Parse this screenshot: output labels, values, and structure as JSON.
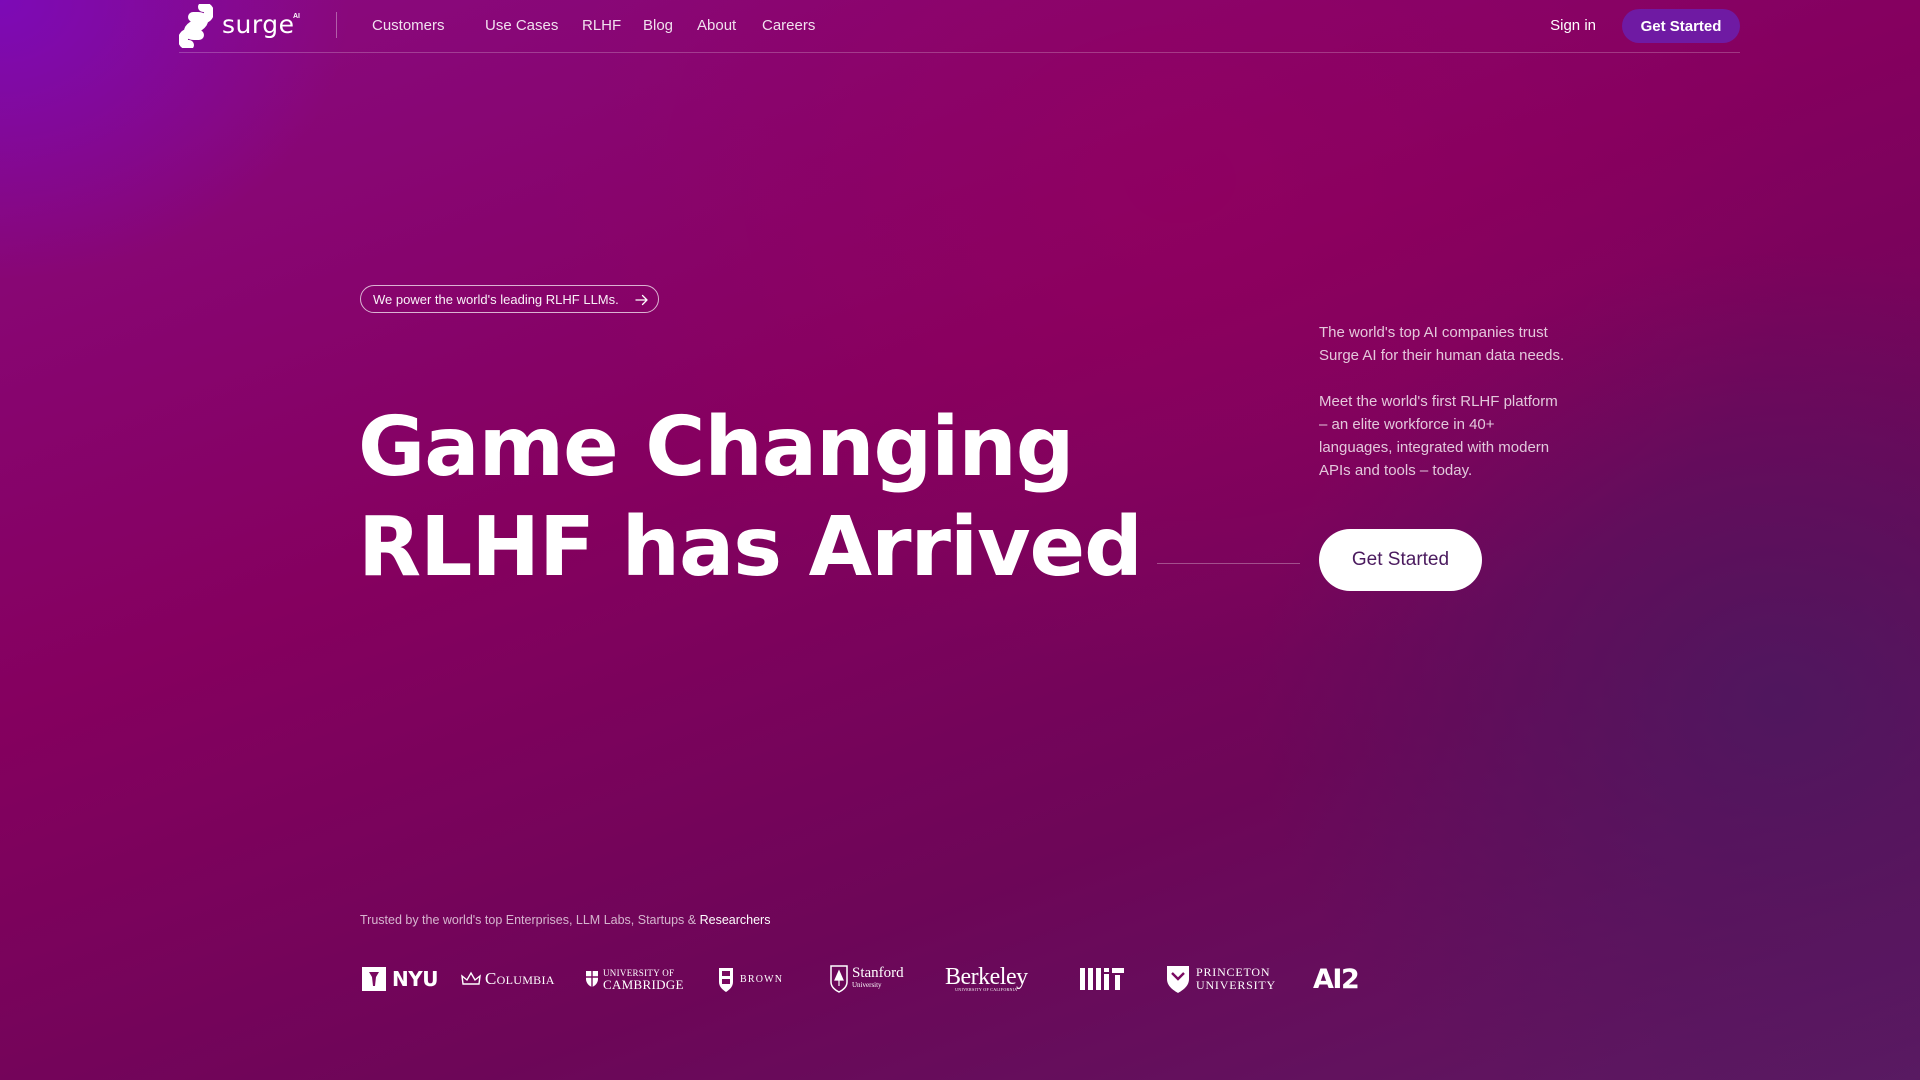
{
  "nav": {
    "logo_text": "surge",
    "logo_superscript": "AI",
    "links": [
      "Customers",
      "Use Cases",
      "RLHF",
      "Blog",
      "About",
      "Careers"
    ],
    "sign_in": "Sign in",
    "cta": "Get Started"
  },
  "hero": {
    "pill_text": "We power the world's leading RLHF LLMs.",
    "headline_line1": "Game Changing",
    "headline_line2": "RLHF has Arrived",
    "side_para1": "The world's top AI companies trust Surge AI for their human data needs.",
    "side_para2": "Meet the world's first RLHF platform – an elite workforce in 40+ languages, integrated with modern APIs and tools – today.",
    "cta": "Get Started"
  },
  "trusted": {
    "text": "Trusted by the world's top Enterprises, LLM Labs, Startups & ",
    "highlight": "Researchers",
    "logos": {
      "nyu": "NYU",
      "columbia": "Columbia",
      "cambridge_line1": "UNIVERSITY OF",
      "cambridge_line2": "CAMBRIDGE",
      "brown": "BROWN",
      "stanford_line1": "Stanford",
      "stanford_line2": "University",
      "berkeley_line1": "Berkeley",
      "berkeley_line2": "UNIVERSITY OF CALIFORNIA",
      "princeton_line1": "PRINCETON",
      "princeton_line2": "UNIVERSITY",
      "ai2": "AI2"
    }
  },
  "colors": {
    "accent_button": "#6f1aa3",
    "cta_text": "#4a1a5e"
  },
  "icons": {
    "logo": "surge-s-logo-icon",
    "pill_arrow": "arrow-right-icon"
  }
}
